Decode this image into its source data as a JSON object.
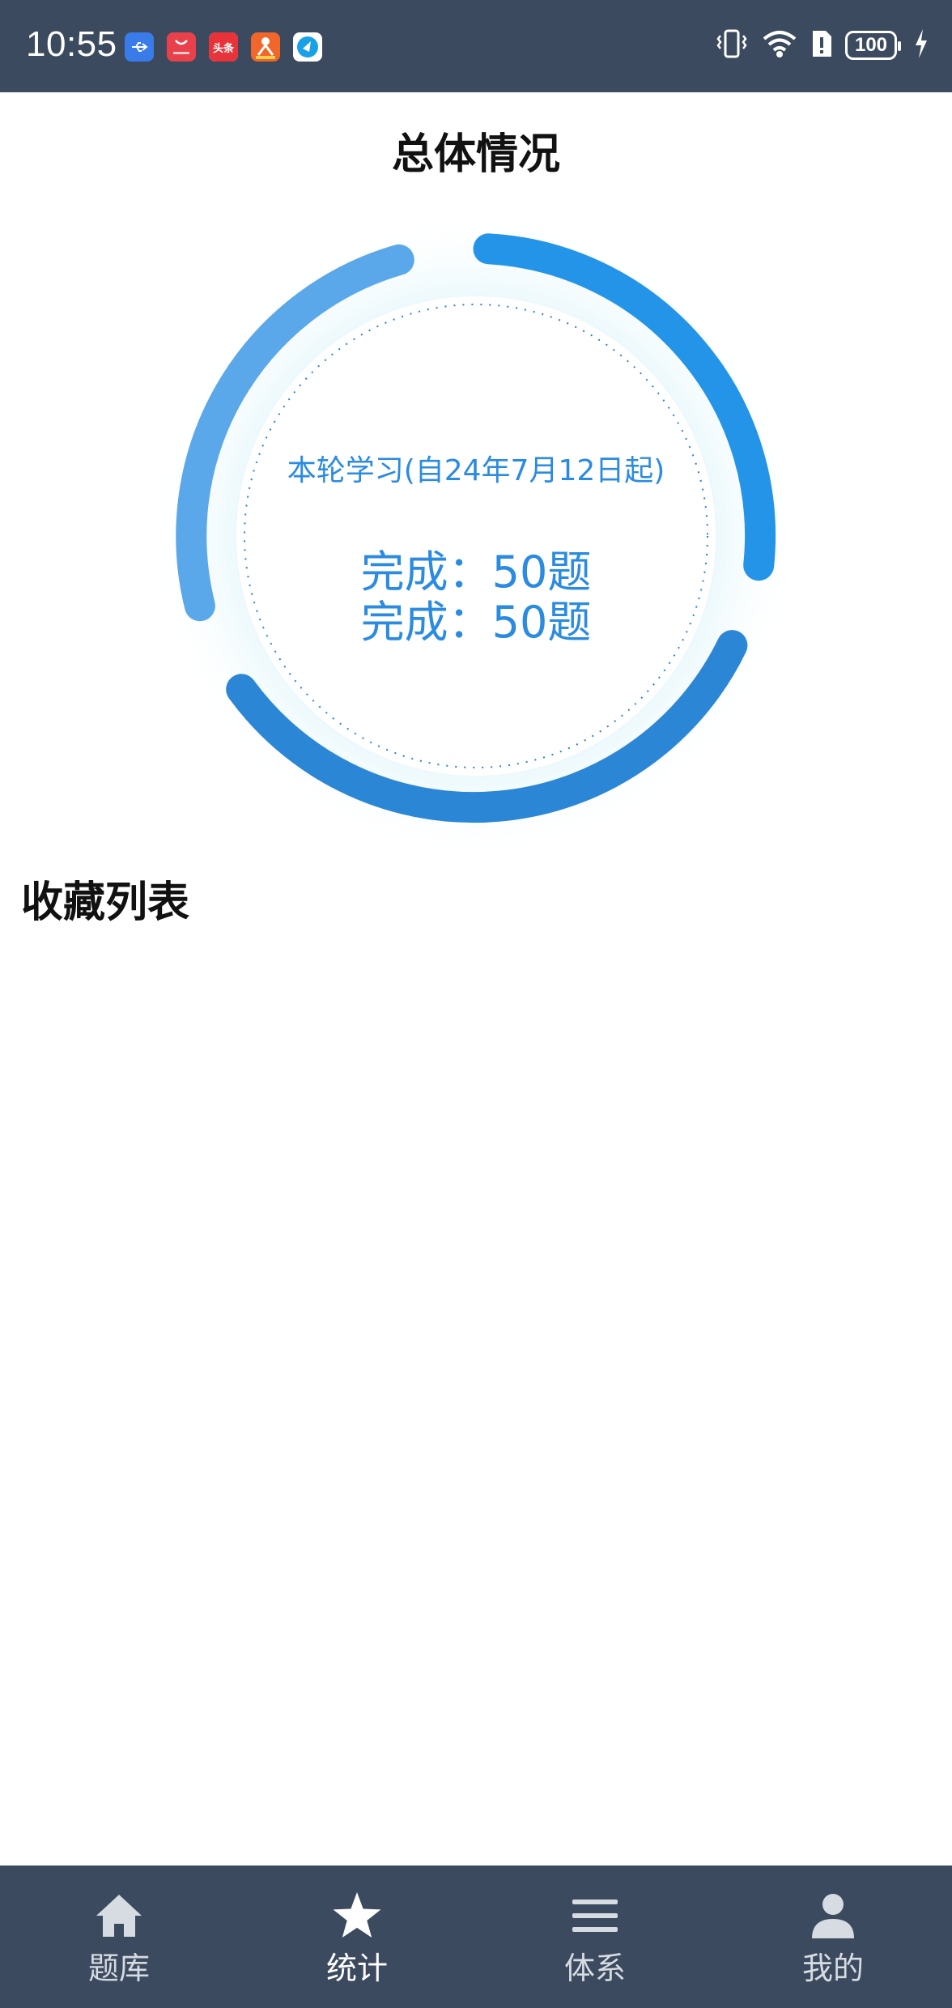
{
  "status_bar": {
    "time": "10:55",
    "app_icons": [
      "usb-icon",
      "huawei-appgallery-icon",
      "toutiao-icon",
      "app-icon-orange",
      "tencent-icon"
    ],
    "toutiao_text": "头条",
    "battery": "100",
    "colors": {
      "background": "#3b4a5e"
    }
  },
  "overview": {
    "title": "总体情况",
    "round_label": "本轮学习(自24年7月12日起)",
    "line1": "完成：50题",
    "line2": "完成：50题"
  },
  "favorites": {
    "title": "收藏列表"
  },
  "bottom_nav": {
    "items": [
      {
        "label": "题库",
        "icon": "home-icon",
        "active": false
      },
      {
        "label": "统计",
        "icon": "star-icon",
        "active": true
      },
      {
        "label": "体系",
        "icon": "menu-icon",
        "active": false
      },
      {
        "label": "我的",
        "icon": "person-icon",
        "active": false
      }
    ]
  },
  "colors": {
    "ring_light": "#5aa8ea",
    "ring_mid": "#2494e8",
    "ring_dark": "#2c86d6",
    "text_accent": "#2a8be0"
  }
}
